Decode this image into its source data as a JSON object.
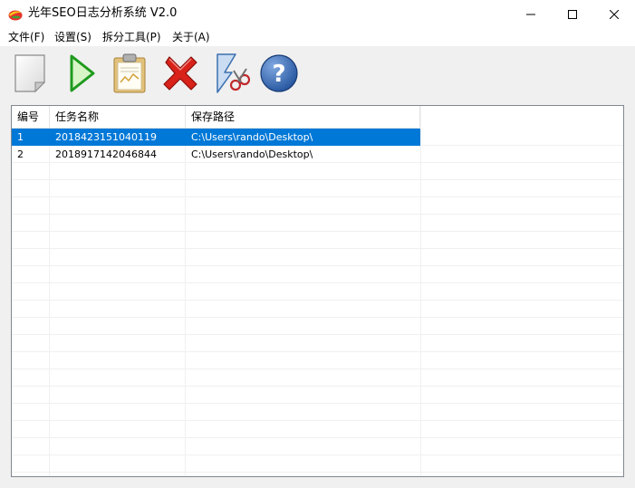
{
  "window": {
    "title": "光年SEO日志分析系统 V2.0",
    "controls": {
      "minimize": "minimize",
      "maximize": "maximize",
      "close": "close"
    }
  },
  "menu": {
    "items": [
      {
        "label": "文件(F)"
      },
      {
        "label": "设置(S)"
      },
      {
        "label": "拆分工具(P)"
      },
      {
        "label": "关于(A)"
      }
    ]
  },
  "toolbar": {
    "buttons": [
      {
        "icon": "new-task-icon"
      },
      {
        "icon": "start-icon"
      },
      {
        "icon": "report-icon"
      },
      {
        "icon": "delete-icon"
      },
      {
        "icon": "split-tool-icon"
      },
      {
        "icon": "help-icon"
      }
    ]
  },
  "task_list": {
    "columns": [
      {
        "label": "编号"
      },
      {
        "label": "任务名称"
      },
      {
        "label": "保存路径"
      }
    ],
    "rows": [
      {
        "id": "1",
        "name": "2018423151040119",
        "path": "C:\\Users\\rando\\Desktop\\",
        "selected": true
      },
      {
        "id": "2",
        "name": "2018917142046844",
        "path": "C:\\Users\\rando\\Desktop\\",
        "selected": false
      }
    ]
  },
  "colors": {
    "selection": "#0078d7",
    "grid": "#f0f0f0",
    "border": "#828790"
  }
}
